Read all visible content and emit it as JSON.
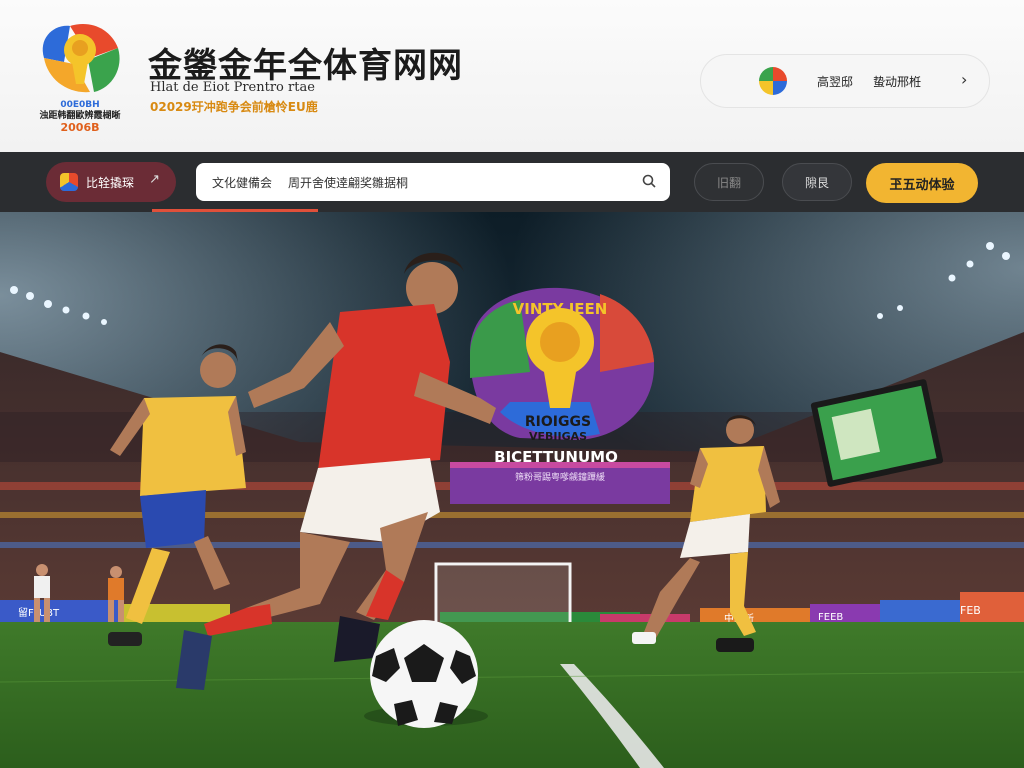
{
  "header": {
    "title": "金鎣金年全体育网网",
    "subtitle": "Hlat de Eiot Prentro rtae",
    "slogan": "02029玗冲跑争会前槍怜EU鹿",
    "logo_caption_1": "00E0BH",
    "logo_caption_2": "浊距韩翻歐辨霞楜晰",
    "logo_caption_3": "2006B",
    "brand_colors": {
      "orange": "#e0601c",
      "gold": "#d88a12",
      "blue": "#2d6bd9"
    }
  },
  "user_menu": {
    "link_1": "高翌邸",
    "link_2": "蛰动邢栣",
    "chevron": "›"
  },
  "nav": {
    "active_label": "比辁撬琛",
    "active_chevron": "↗",
    "search_category": "文化健備会",
    "search_placeholder": "周开舍使逹翩奖雛据桐",
    "ghost_1": "旧翻",
    "ghost_2": "隙艮",
    "cta_label": "玊五动体验",
    "accent": "#f2b531"
  },
  "hero": {
    "emblem_title": "BICETTUNUMO",
    "emblem_line_1": "RIOIGGS",
    "emblem_line_2": "VEBIIGAS",
    "arc_text": "VINTY IEEN",
    "banner_text": "筛粉哥踢粤嗲觎鐘蹕緩",
    "ad_board_1": "留FLUBT",
    "ad_board_2": "中動新",
    "ad_board_3": "FEEB",
    "ad_board_4": "FEB"
  }
}
